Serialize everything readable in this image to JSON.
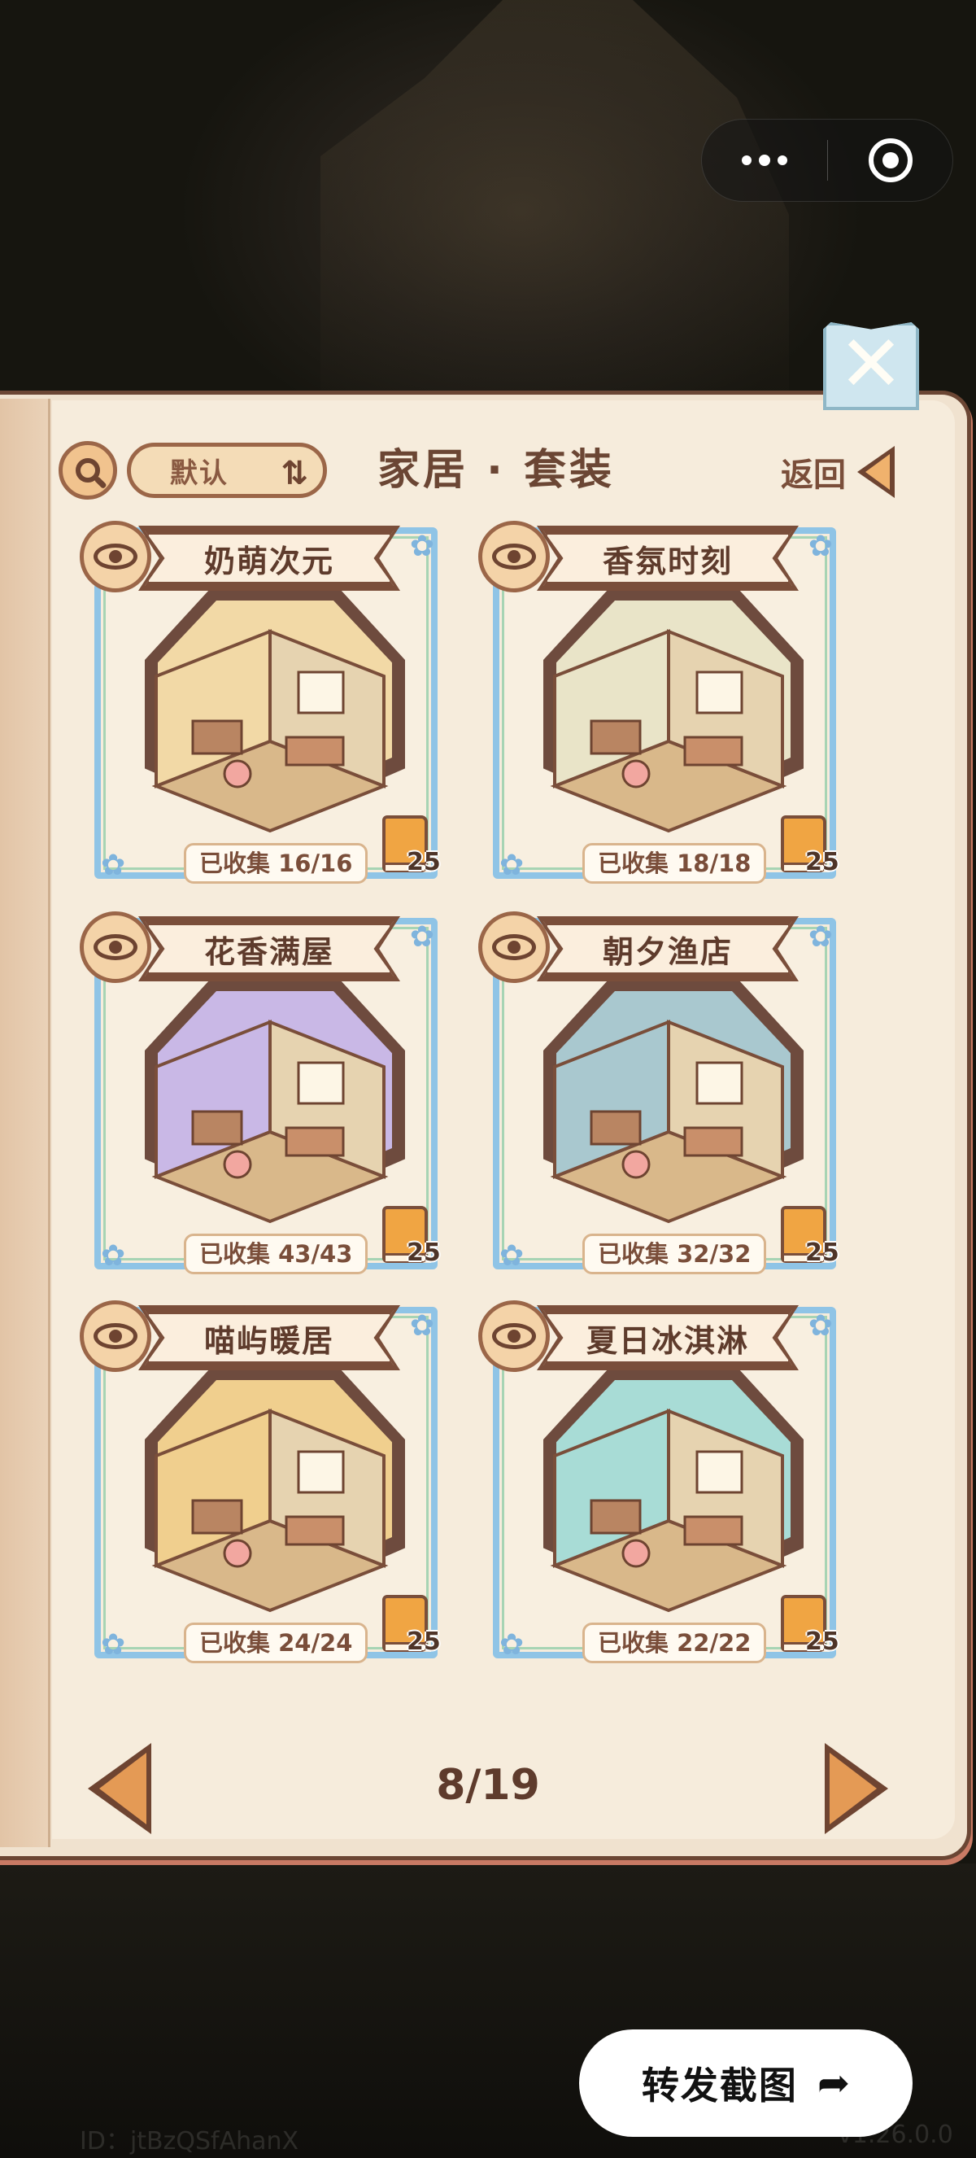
{
  "header": {
    "sort_label": "默认",
    "title": "家居 · 套装",
    "back_label": "返回"
  },
  "sets": [
    {
      "name": "奶萌次元",
      "collected": "已收集 16/16",
      "book_count": "25",
      "theme": "#f2d9a6"
    },
    {
      "name": "香氛时刻",
      "collected": "已收集 18/18",
      "book_count": "25",
      "theme": "#e9e4c8"
    },
    {
      "name": "花香满屋",
      "collected": "已收集 43/43",
      "book_count": "25",
      "theme": "#c9b8e6"
    },
    {
      "name": "朝夕渔店",
      "collected": "已收集 32/32",
      "book_count": "25",
      "theme": "#a9c8cf"
    },
    {
      "name": "喵屿暖居",
      "collected": "已收集 24/24",
      "book_count": "25",
      "theme": "#f0cf8e"
    },
    {
      "name": "夏日冰淇淋",
      "collected": "已收集 22/22",
      "book_count": "25",
      "theme": "#a8dcd6"
    }
  ],
  "pagination": {
    "current": 8,
    "total": 19,
    "label": "8/19"
  },
  "share_label": "转发截图",
  "user_id": "ID：jtBzQSfAhanX",
  "version": "v1.26.0.0",
  "icons": [
    "search-icon",
    "sort-icon",
    "back-arrow-icon",
    "eye-icon",
    "book-icon",
    "close-icon",
    "more-icon",
    "share-icon",
    "prev-page-icon",
    "next-page-icon"
  ]
}
